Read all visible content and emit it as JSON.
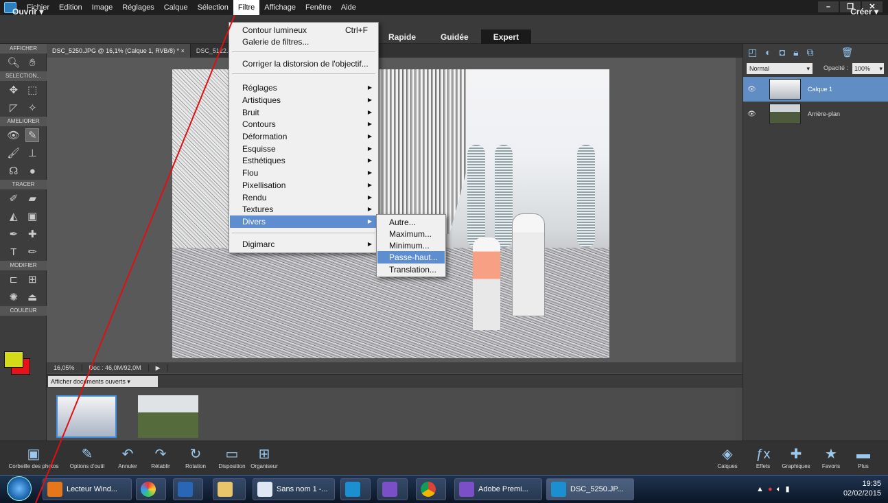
{
  "menubar": {
    "items": [
      "Fichier",
      "Edition",
      "Image",
      "Réglages",
      "Calque",
      "Sélection",
      "Filtre",
      "Affichage",
      "Fenêtre",
      "Aide"
    ],
    "active": "Filtre",
    "window_controls": [
      "–",
      "❐",
      "✕"
    ]
  },
  "header": {
    "open_label": "Ouvrir",
    "modes": [
      "Rapide",
      "Guidée",
      "Expert"
    ],
    "selected_mode": "Expert",
    "create_label": "Créer"
  },
  "toolpanel": {
    "sections": [
      "AFFICHER",
      "SELECTION...",
      "AMELIORER",
      "TRACER",
      "MODIFIER",
      "COULEUR"
    ],
    "foreground_color": "#d4dc1a",
    "background_color": "#e8121a"
  },
  "tabs": [
    {
      "label": "DSC_5250.JPG @ 16,1% (Calque 1, RVB/8) * ×"
    },
    {
      "label": "DSC_5122.JP..."
    }
  ],
  "status": {
    "zoom": "16,05%",
    "doc": "Doc : 46,0M/92,0M"
  },
  "bin": {
    "select_label": "Afficher documents ouverts"
  },
  "layers": {
    "blend_mode": "Normal",
    "opacity_label": "Opacité :",
    "opacity_value": "100%",
    "items": [
      {
        "name": "Calque 1",
        "selected": true
      },
      {
        "name": "Arrière-plan",
        "selected": false
      }
    ]
  },
  "filter_menu": {
    "items": [
      {
        "label": "Contour lumineux",
        "shortcut": "Ctrl+F"
      },
      {
        "label": "Galerie de filtres..."
      },
      {
        "label": "Corriger la distorsion de l'objectif..."
      },
      {
        "label": "Réglages",
        "submenu": true
      },
      {
        "label": "Artistiques",
        "submenu": true
      },
      {
        "label": "Bruit",
        "submenu": true
      },
      {
        "label": "Contours",
        "submenu": true
      },
      {
        "label": "Déformation",
        "submenu": true
      },
      {
        "label": "Esquisse",
        "submenu": true
      },
      {
        "label": "Esthétiques",
        "submenu": true
      },
      {
        "label": "Flou",
        "submenu": true
      },
      {
        "label": "Pixellisation",
        "submenu": true
      },
      {
        "label": "Rendu",
        "submenu": true
      },
      {
        "label": "Textures",
        "submenu": true
      },
      {
        "label": "Divers",
        "submenu": true,
        "highlighted": true
      },
      {
        "label": "Digimarc",
        "submenu": true
      }
    ]
  },
  "divers_submenu": {
    "items": [
      "Autre...",
      "Maximum...",
      "Minimum...",
      "Passe-haut...",
      "Translation..."
    ],
    "highlighted": "Passe-haut..."
  },
  "bottombar": {
    "left": [
      "Corbeille des photos",
      "Options d'outil",
      "Annuler",
      "Rétablir",
      "Rotation",
      "Disposition",
      "Organiseur"
    ],
    "right": [
      "Calques",
      "Effets",
      "Graphiques",
      "Favoris",
      "Plus"
    ]
  },
  "taskbar": {
    "items": [
      "Lecteur Wind...",
      "Sans nom 1 -...",
      "Adobe Premi...",
      "DSC_5250.JP..."
    ],
    "time": "19:35",
    "date": "02/02/2015"
  }
}
